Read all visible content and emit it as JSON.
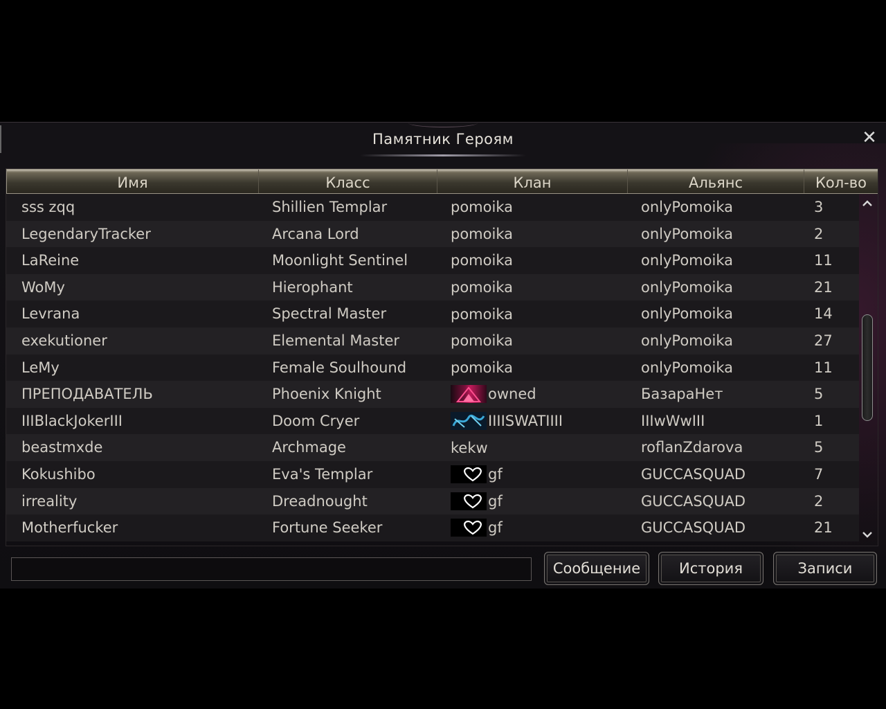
{
  "window": {
    "title": "Памятник Героям",
    "close_symbol": "✕"
  },
  "table": {
    "columns": [
      "Имя",
      "Класс",
      "Клан",
      "Альянс",
      "Кол-во"
    ],
    "rows": [
      {
        "name": "sss zqq",
        "class": "Shillien Templar",
        "clan": "pomoika",
        "crest": "",
        "alliance": "onlyPomoika",
        "count": "3"
      },
      {
        "name": "LegendaryTracker",
        "class": "Arcana Lord",
        "clan": "pomoika",
        "crest": "",
        "alliance": "onlyPomoika",
        "count": "2"
      },
      {
        "name": "LaReine",
        "class": "Moonlight Sentinel",
        "clan": "pomoika",
        "crest": "",
        "alliance": "onlyPomoika",
        "count": "11"
      },
      {
        "name": "WoMy",
        "class": "Hierophant",
        "clan": "pomoika",
        "crest": "",
        "alliance": "onlyPomoika",
        "count": "21"
      },
      {
        "name": "Levrana",
        "class": "Spectral Master",
        "clan": "pomoika",
        "crest": "",
        "alliance": "onlyPomoika",
        "count": "14"
      },
      {
        "name": "exekutioner",
        "class": "Elemental Master",
        "clan": "pomoika",
        "crest": "",
        "alliance": "onlyPomoika",
        "count": "27"
      },
      {
        "name": "LeMy",
        "class": "Female Soulhound",
        "clan": "pomoika",
        "crest": "",
        "alliance": "onlyPomoika",
        "count": "11"
      },
      {
        "name": "ПРЕПОДАВАТЕЛЬ",
        "class": "Phoenix Knight",
        "clan": "owned",
        "crest": "triangle",
        "alliance": "БазараНет",
        "count": "5"
      },
      {
        "name": "IIIBlackJokerIII",
        "class": "Doom Cryer",
        "clan": "IIIISWATIIII",
        "crest": "swat",
        "alliance": "IIIwWwIII",
        "count": "1"
      },
      {
        "name": "beastmxde",
        "class": "Archmage",
        "clan": "kekw",
        "crest": "",
        "alliance": "roflanZdarova",
        "count": "5"
      },
      {
        "name": "Kokushibo",
        "class": "Eva's Templar",
        "clan": "gf",
        "crest": "heart",
        "alliance": "GUCCASQUAD",
        "count": "7"
      },
      {
        "name": "irreality",
        "class": "Dreadnought",
        "clan": "gf",
        "crest": "heart",
        "alliance": "GUCCASQUAD",
        "count": "2"
      },
      {
        "name": "Motherfucker",
        "class": "Fortune Seeker",
        "clan": "gf",
        "crest": "heart",
        "alliance": "GUCCASQUAD",
        "count": "21"
      }
    ]
  },
  "scrollbar": {
    "up_symbol": "^",
    "down_symbol": "⌄"
  },
  "bottom": {
    "input_value": "",
    "message_button": "Сообщение",
    "history_button": "История",
    "records_button": "Записи"
  },
  "colors": {
    "crest_triangle": "#c01a5a",
    "crest_swat": "#3aa8d8",
    "crest_heart": "#ffffff"
  }
}
